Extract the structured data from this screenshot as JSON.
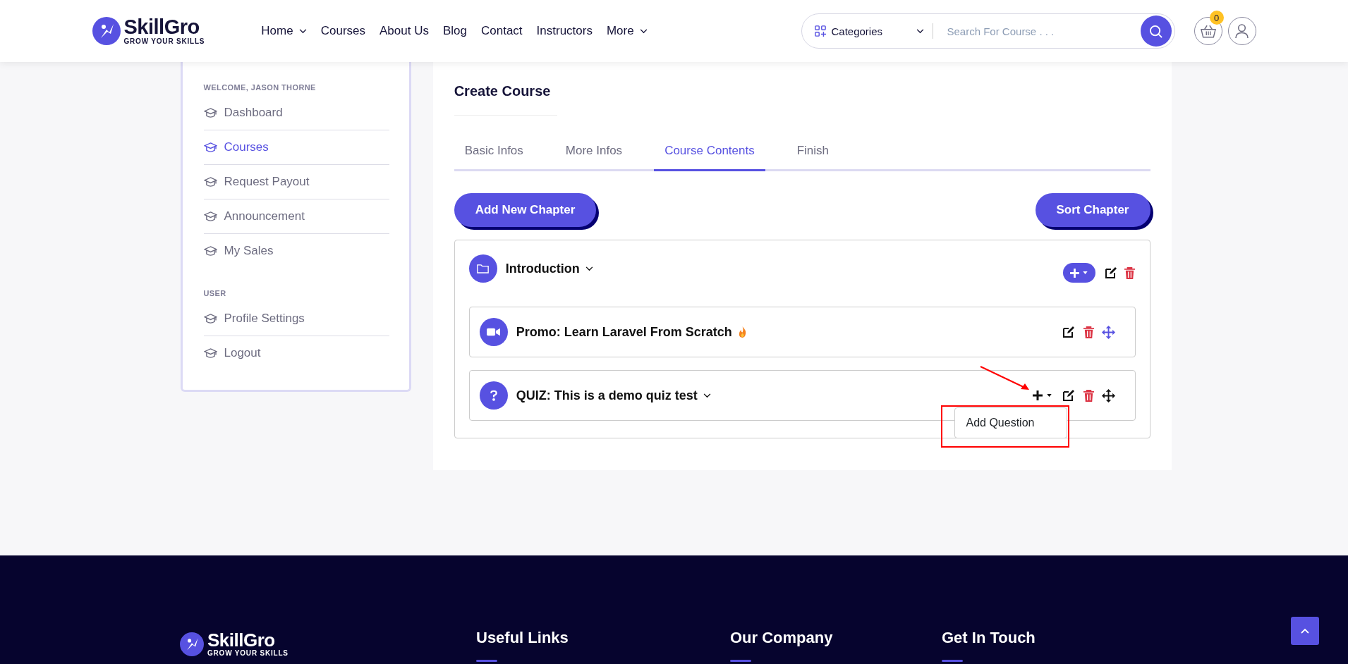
{
  "header": {
    "logo": {
      "name": "SkillGro",
      "tagline": "GROW YOUR SKILLS"
    },
    "nav": [
      {
        "label": "Home",
        "dropdown": true
      },
      {
        "label": "Courses",
        "dropdown": false
      },
      {
        "label": "About Us",
        "dropdown": false
      },
      {
        "label": "Blog",
        "dropdown": false
      },
      {
        "label": "Contact",
        "dropdown": false
      },
      {
        "label": "Instructors",
        "dropdown": false
      },
      {
        "label": "More",
        "dropdown": true
      }
    ],
    "search": {
      "category": "Categories",
      "placeholder": "Search For Course . . ."
    },
    "cart_count": "0"
  },
  "sidebar": {
    "sections": [
      {
        "heading": "WELCOME, JASON THORNE",
        "items": [
          {
            "label": "Dashboard",
            "selected": false
          },
          {
            "label": "Courses",
            "selected": true
          },
          {
            "label": "Request Payout",
            "selected": false
          },
          {
            "label": "Announcement",
            "selected": false
          },
          {
            "label": "My Sales",
            "selected": false
          }
        ]
      },
      {
        "heading": "USER",
        "items": [
          {
            "label": "Profile Settings",
            "selected": false
          },
          {
            "label": "Logout",
            "selected": false
          }
        ]
      }
    ]
  },
  "main": {
    "title": "Create Course",
    "tabs": [
      {
        "label": "Basic Infos",
        "selected": false
      },
      {
        "label": "More Infos",
        "selected": false
      },
      {
        "label": "Course Contents",
        "selected": true
      },
      {
        "label": "Finish",
        "selected": false
      }
    ],
    "buttons": [
      "Add New Chapter",
      "Sort Chapter"
    ],
    "chapters": [
      {
        "title": "Introduction",
        "items": [
          {
            "kind": "video",
            "title": "Promo: Learn Laravel From Scratch"
          },
          {
            "kind": "quiz",
            "title": "QUIZ: This is a demo quiz test",
            "menu": [
              "Add Question"
            ]
          }
        ]
      }
    ]
  },
  "footer": {
    "logo": {
      "name": "SkillGro",
      "tagline": "GROW YOUR SKILLS"
    },
    "headings": [
      "Useful Links",
      "Our Company",
      "Get In Touch"
    ]
  }
}
